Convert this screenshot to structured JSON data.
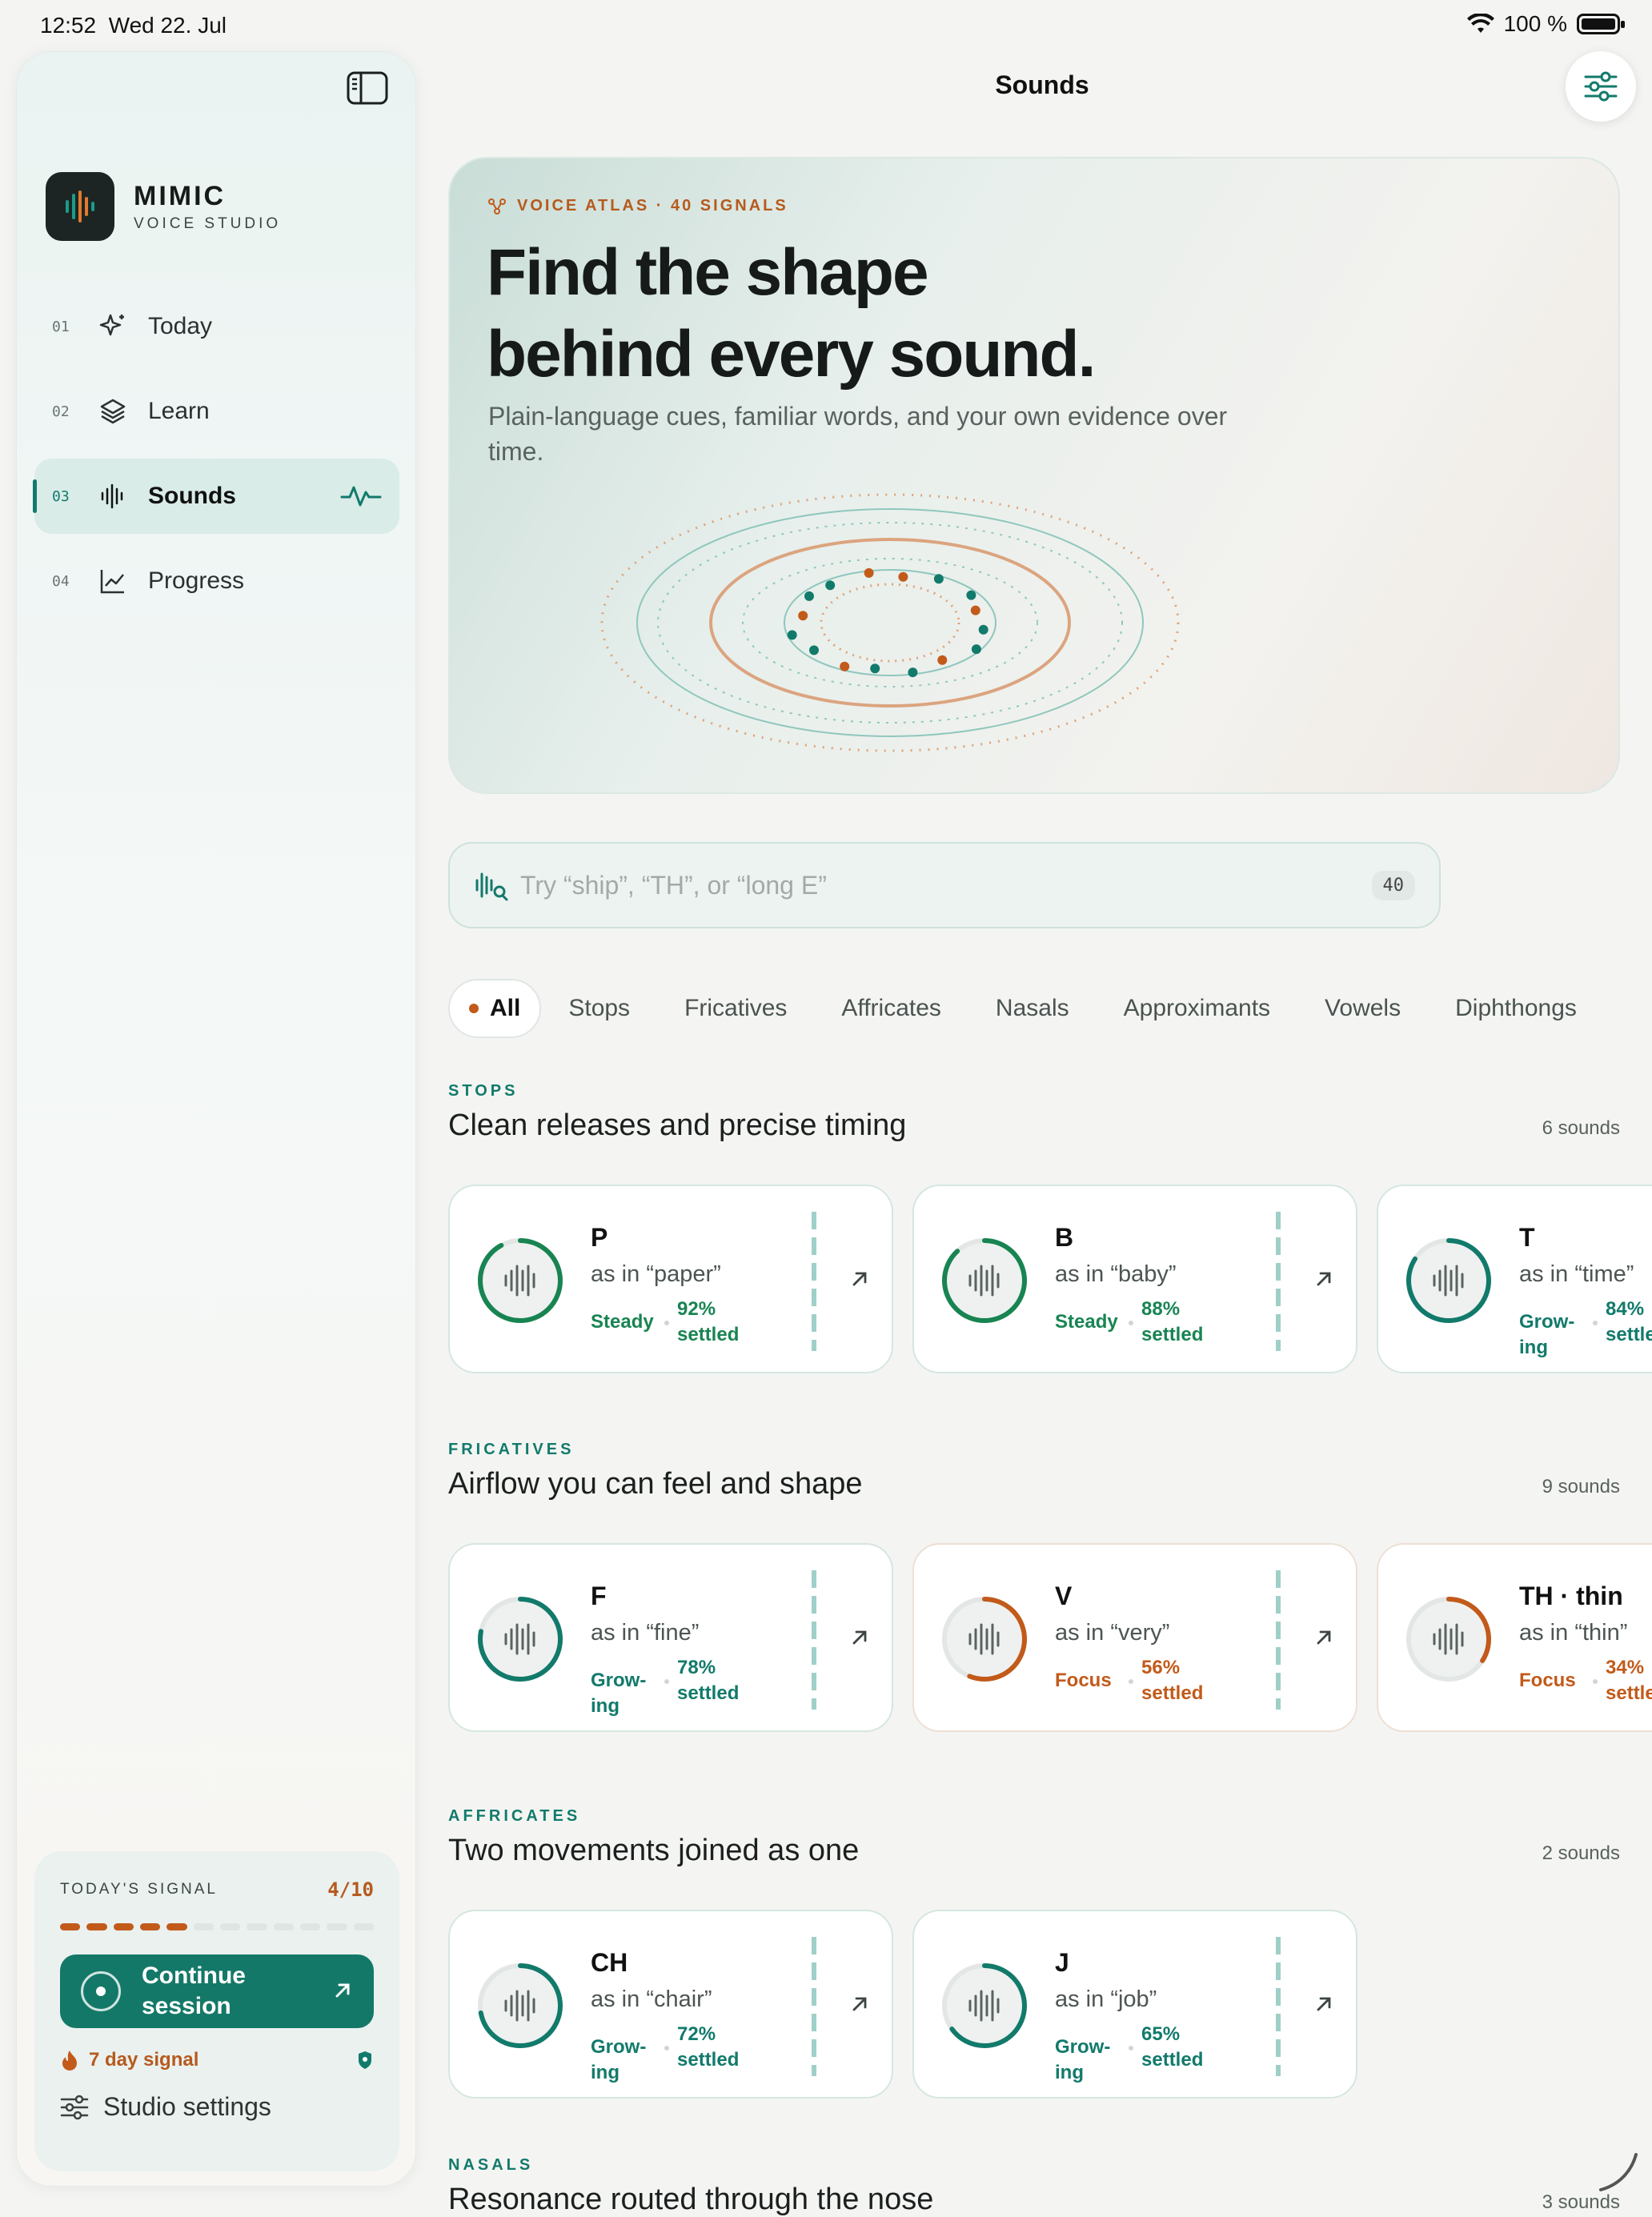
{
  "status_bar": {
    "time": "12:52",
    "date": "Wed 22. Jul",
    "battery": "100 %"
  },
  "sidebar": {
    "brand_name": "MIMIC",
    "brand_sub": "VOICE STUDIO",
    "nav": [
      {
        "num": "01",
        "label": "Today",
        "icon": "sparkle-icon"
      },
      {
        "num": "02",
        "label": "Learn",
        "icon": "layers-icon"
      },
      {
        "num": "03",
        "label": "Sounds",
        "icon": "waveform-icon",
        "active": true
      },
      {
        "num": "04",
        "label": "Progress",
        "icon": "chart-icon"
      }
    ],
    "signal": {
      "title": "TODAY'S SIGNAL",
      "count": "4/10",
      "progress_done": 5,
      "progress_total": 12,
      "continue_label": "Continue session",
      "streak_label": "7 day signal",
      "settings_label": "Studio settings"
    }
  },
  "header": {
    "title": "Sounds"
  },
  "hero": {
    "kicker": "VOICE ATLAS · 40 SIGNALS",
    "title_line1": "Find the shape",
    "title_line2": "behind every sound.",
    "subtitle": "Plain-language cues, familiar words, and your own evidence over time."
  },
  "search": {
    "placeholder": "Try “ship”, “TH”, or “long E”",
    "count": "40"
  },
  "chips": [
    "All",
    "Stops",
    "Fricatives",
    "Affricates",
    "Nasals",
    "Approximants",
    "Vowels",
    "Diphthongs"
  ],
  "sections": [
    {
      "kicker": "STOPS",
      "title": "Clean releases and precise timing",
      "count": "6 sounds",
      "cards": [
        {
          "letter": "P",
          "asin": "as in “paper”",
          "status": "Steady",
          "pct": "92%",
          "pct_label": "settled",
          "level": 0.92,
          "tone": "steady"
        },
        {
          "letter": "B",
          "asin": "as in “baby”",
          "status": "Steady",
          "pct": "88%",
          "pct_label": "settled",
          "level": 0.88,
          "tone": "steady"
        },
        {
          "letter": "T",
          "asin": "as in “time”",
          "status": "Grow-ing",
          "pct": "84%",
          "pct_label": "settled",
          "level": 0.84,
          "tone": "grow"
        }
      ]
    },
    {
      "kicker": "FRICATIVES",
      "title": "Airflow you can feel and shape",
      "count": "9 sounds",
      "cards": [
        {
          "letter": "F",
          "asin": "as in “fine”",
          "status": "Grow-ing",
          "pct": "78%",
          "pct_label": "settled",
          "level": 0.78,
          "tone": "grow"
        },
        {
          "letter": "V",
          "asin": "as in “very”",
          "status": "Focus",
          "pct": "56%",
          "pct_label": "settled",
          "level": 0.56,
          "tone": "focus"
        },
        {
          "letter": "TH · thin",
          "asin": "as in “thin”",
          "status": "Focus",
          "pct": "34%",
          "pct_label": "settled",
          "level": 0.34,
          "tone": "focus"
        }
      ]
    },
    {
      "kicker": "AFFRICATES",
      "title": "Two movements joined as one",
      "count": "2 sounds",
      "cards": [
        {
          "letter": "CH",
          "asin": "as in “chair”",
          "status": "Grow-ing",
          "pct": "72%",
          "pct_label": "settled",
          "level": 0.72,
          "tone": "grow"
        },
        {
          "letter": "J",
          "asin": "as in “job”",
          "status": "Grow-ing",
          "pct": "65%",
          "pct_label": "settled",
          "level": 0.65,
          "tone": "grow"
        }
      ]
    },
    {
      "kicker": "NASALS",
      "title": "Resonance routed through the nose",
      "count": "3 sounds",
      "cards": []
    }
  ],
  "colors": {
    "accent": "#127a6b",
    "steady": "#188452",
    "focus": "#c25a1a",
    "track": "#e2e7e5"
  }
}
